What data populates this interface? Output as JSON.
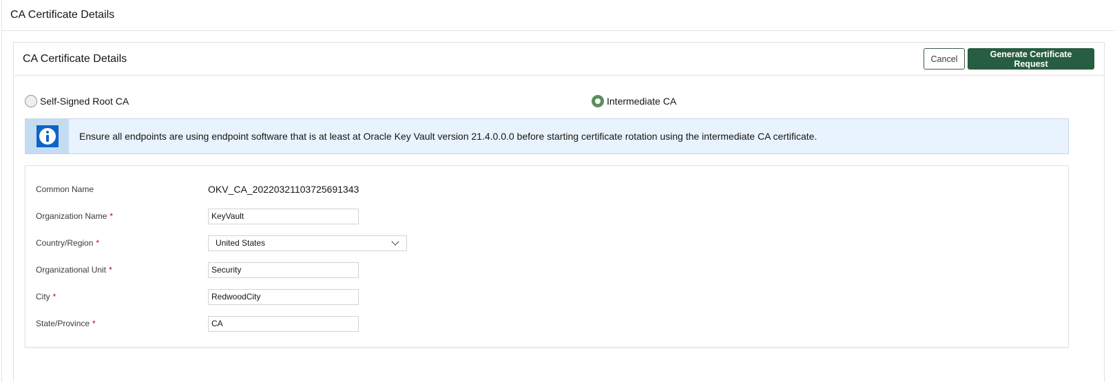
{
  "page": {
    "title": "CA Certificate Details"
  },
  "card": {
    "title": "CA Certificate Details",
    "cancel_label": "Cancel",
    "primary_label": "Generate Certificate Request"
  },
  "ca_type": {
    "options": [
      {
        "label": "Self-Signed Root CA",
        "selected": false
      },
      {
        "label": "Intermediate CA",
        "selected": true
      }
    ]
  },
  "banner": {
    "icon": "info-icon",
    "text": "Ensure all endpoints are using endpoint software that is at least at Oracle Key Vault version 21.4.0.0.0 before starting certificate rotation using the intermediate CA certificate."
  },
  "form": {
    "common_name": {
      "label": "Common Name",
      "value": "OKV_CA_20220321103725691343"
    },
    "organization_name": {
      "label": "Organization Name",
      "required": "*",
      "value": "KeyVault"
    },
    "country": {
      "label": "Country/Region",
      "required": "*",
      "value": "United States"
    },
    "org_unit": {
      "label": "Organizational Unit",
      "required": "*",
      "value": "Security"
    },
    "city": {
      "label": "City",
      "required": "*",
      "value": "RedwoodCity"
    },
    "state": {
      "label": "State/Province",
      "required": "*",
      "value": "CA"
    }
  },
  "colors": {
    "primary": "#275e41",
    "radio_selected": "#5a8f5c",
    "info": "#0d63c6",
    "banner_bg": "#e8f3fd",
    "required": "#d10000"
  }
}
